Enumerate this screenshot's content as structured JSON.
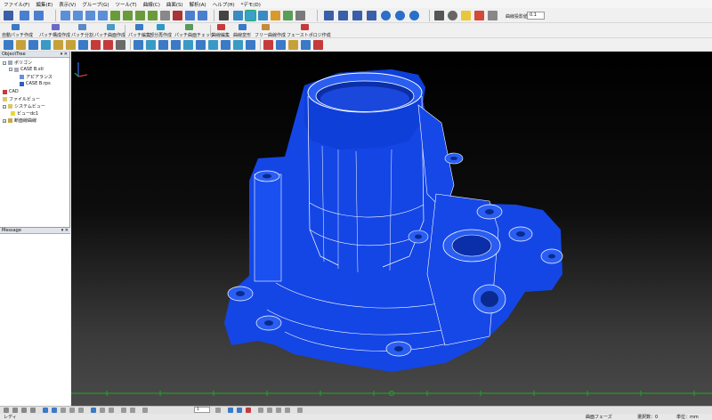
{
  "menu": [
    "ファイル(F)",
    "編集(E)",
    "表示(V)",
    "グループ(G)",
    "ツール(T)",
    "曲線(C)",
    "曲面(S)",
    "解析(A)",
    "ヘルプ(H)",
    "*デモ(D)"
  ],
  "toolbar": {
    "tolerance_label": "曲線投影値:",
    "tolerance_value": "0.1",
    "row2_labels": [
      "自動パッチ作成",
      "パッチ構成作成",
      "パッチ分割",
      "パッチ曲面作成",
      "パッチ編集",
      "部分再作成",
      "パッチ曲面チェック",
      "曲線編集",
      "曲線変形",
      "フリー曲線作成",
      "フェーストポロジ作成"
    ]
  },
  "object_tree": {
    "title": "ObjectTree",
    "items": [
      {
        "label": "ポリゴン",
        "level": 0
      },
      {
        "label": "CASE B.stl",
        "level": 1
      },
      {
        "label": "アピアランス",
        "level": 2
      },
      {
        "label": "CASE B.rps",
        "level": 2
      },
      {
        "label": "CAD",
        "level": 0
      },
      {
        "label": "ファイルビュー",
        "level": 0
      },
      {
        "label": "システムビュー",
        "level": 0
      },
      {
        "label": "ビューdc1",
        "level": 1
      },
      {
        "label": "断面線曲線",
        "level": 0
      }
    ]
  },
  "message_pane": {
    "title": "Message"
  },
  "status": {
    "left": "レディ",
    "phase": "曲面フェーズ",
    "selection": "選択数：0",
    "unit": "単位：mm"
  },
  "bottom_toolbar": {
    "page_value": "1"
  },
  "colors": {
    "model": "#1446e6",
    "edges": "#ffffff",
    "background_top": "#000000",
    "background_bottom": "#4a4a4a",
    "axis_green": "#1fa81f"
  }
}
